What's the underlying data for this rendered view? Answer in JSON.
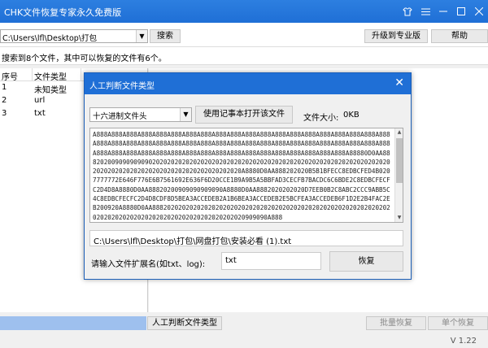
{
  "window": {
    "title": "CHK文件恢复专家永久免费版",
    "controls": [
      "shirt-icon",
      "menu-icon",
      "minimize-icon",
      "maximize-icon",
      "close-icon"
    ]
  },
  "toolbar": {
    "path_value": "C:\\Users\\lfl\\Desktop\\打包",
    "search_label": "搜索",
    "upgrade_label": "升级到专业版",
    "help_label": "帮助"
  },
  "status": {
    "text": "搜索到8个文件，其中可以恢复的文件有6个。"
  },
  "file_list": {
    "columns": [
      "序号",
      "文件类型"
    ],
    "rows": [
      {
        "no": "1",
        "type": "未知类型"
      },
      {
        "no": "2",
        "type": "url"
      },
      {
        "no": "3",
        "type": "txt"
      }
    ]
  },
  "bottom": {
    "progress_fraction": 1.0,
    "manual_label": "人工判断文件类型",
    "batch_label": "批量恢复",
    "single_label": "单个恢复",
    "version": "V 1.22"
  },
  "dialog": {
    "title": "人工判断文件类型",
    "mode_value": "十六进制文件头",
    "notepad_label": "使用记事本打开该文件",
    "size_label": "文件大小:",
    "size_value": "0KB",
    "hex_content": "A888A888A888A888A888A888A888A888A888A888A888A888A888A888A888A888A888A888A888A888A888A888A888A888A888A888A888A888A888A888A888A888A888A888A888A888A888A888A888A888A888A888A888A888A888A888A888A888A888A888A888A888A888A888A888A888A888A88880D0AA88820200909090909020202020202020202020202020202020202020202020202020202020202020202020202020202020202020202020202020202020A8880D0AA888202020B5B1BFECC8EDBCFED4B0207777772E646F776E6B7561692E636F6D20CCE1B9A9B5A5BBFAD3CECFB7BACDC6C6BDE2C8EDBCFECFC2D4D8A8880D0AA88820200909090909090A8880D0AA8882020202020D7EEB0B2C8ABC2CCC9ABB5C4C8EDBCFECFC2D4D8CDF8D5BEA3ACCEDEB2A1B6BEA3ACCEDEB2E5BCFEA3ACCEDEB6F1D2E2B4FAC2EB200920A8880D0AA888202020202020202020202020202020202020202020202020202020202020202020202020202020202020202020202020202020909090A888",
    "full_path": "C:\\Users\\lfl\\Desktop\\打包\\网盘打包\\安装必看 (1).txt",
    "ext_label": "请输入文件扩展名(如txt、log):",
    "ext_value": "txt",
    "recover_label": "恢复"
  }
}
